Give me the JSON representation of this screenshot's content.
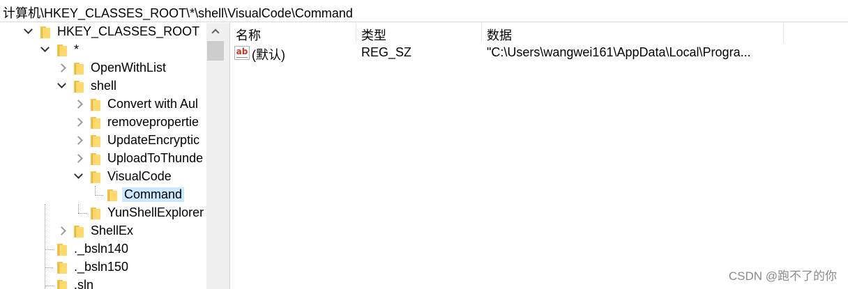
{
  "address_bar": {
    "path": "计算机\\HKEY_CLASSES_ROOT\\*\\shell\\VisualCode\\Command"
  },
  "tree": {
    "items": [
      {
        "label": "HKEY_CLASSES_ROOT",
        "state": "expanded"
      },
      {
        "label": "*",
        "state": "expanded"
      },
      {
        "label": "OpenWithList",
        "state": "collapsed"
      },
      {
        "label": "shell",
        "state": "expanded"
      },
      {
        "label": "Convert with Aul",
        "state": "collapsed"
      },
      {
        "label": "removepropertie",
        "state": "collapsed"
      },
      {
        "label": "UpdateEncryptic",
        "state": "collapsed"
      },
      {
        "label": "UploadToThunde",
        "state": "collapsed"
      },
      {
        "label": "VisualCode",
        "state": "expanded"
      },
      {
        "label": "Command",
        "state": "leaf",
        "selected": true
      },
      {
        "label": "YunShellExplorer",
        "state": "leaf"
      },
      {
        "label": "ShellEx",
        "state": "collapsed"
      },
      {
        "label": "._bsln140",
        "state": "leaf"
      },
      {
        "label": "._bsln150",
        "state": "leaf"
      },
      {
        "label": ".sln",
        "state": "leaf"
      }
    ]
  },
  "list": {
    "columns": {
      "name": "名称",
      "type": "类型",
      "data": "数据"
    },
    "rows": [
      {
        "icon": "string-value-icon",
        "icon_text": "ab",
        "name": "(默认)",
        "type": "REG_SZ",
        "data": "\"C:\\Users\\wangwei161\\AppData\\Local\\Progra..."
      }
    ]
  },
  "watermark": "CSDN @跑不了的你"
}
